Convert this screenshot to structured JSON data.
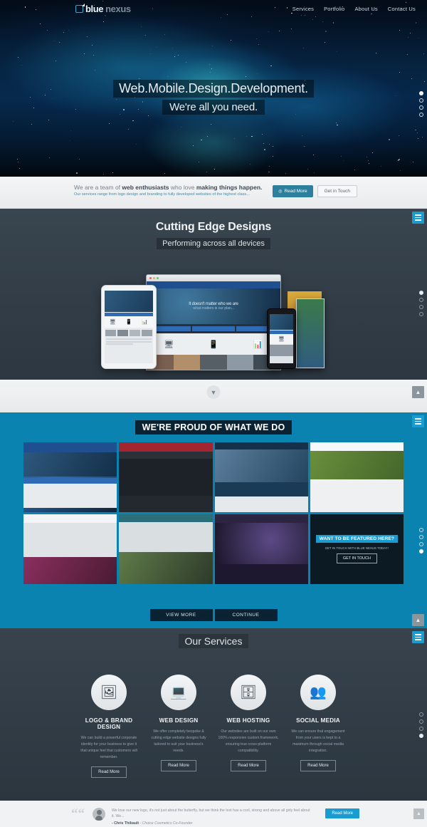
{
  "brand": {
    "logo_blue": "blue",
    "logo_nexus": "nexus",
    "logo_icon": "bluenexus-logo-icon"
  },
  "nav": {
    "items": [
      "Services",
      "Portfolio",
      "About Us",
      "Contact Us"
    ]
  },
  "hero": {
    "line1": "Web.Mobile.Design.Development.",
    "line2": "We're all you need.",
    "dots": 4,
    "active_dot": 0
  },
  "intro": {
    "text_main_a": "We are a team of ",
    "text_main_b": "web enthusiasts",
    "text_main_c": " who love ",
    "text_main_d": "making things happen.",
    "text_sub": "Our services range from logo design and branding to fully developed websites of the highest class...",
    "read_more": "Read More",
    "read_more_icon": "plus-circle-icon",
    "get_in_touch": "Get in Touch"
  },
  "devices": {
    "title": "Cutting Edge Designs",
    "subtitle": "Performing across all devices",
    "menu_icon": "hamburger-menu-icon",
    "browser_headline": "It doesn't matter who we are",
    "browser_subline": "what matters is our plan...",
    "scroll_down_icon": "chevron-down-icon",
    "scroll_top_icon": "arrow-up-icon",
    "dots": 4,
    "active_dot": 0
  },
  "portfolio": {
    "title": "WE'RE PROUD OF WHAT WE DO",
    "menu_icon": "hamburger-menu-icon",
    "items": [
      {
        "name": "portfolio-thumb-1",
        "accent": "#2f6cb5"
      },
      {
        "name": "portfolio-thumb-2",
        "accent": "#a32530"
      },
      {
        "name": "portfolio-thumb-3",
        "accent": "#1d4a72"
      },
      {
        "name": "portfolio-thumb-4",
        "accent": "#6a8f3c"
      },
      {
        "name": "portfolio-thumb-5",
        "accent": "#8a2f5e"
      },
      {
        "name": "portfolio-thumb-6",
        "accent": "#2a6e7a"
      },
      {
        "name": "portfolio-thumb-7",
        "accent": "#3a3050"
      },
      {
        "name": "portfolio-thumb-8",
        "accent": "#0c1a24"
      }
    ],
    "featured": {
      "headline": "WANT TO BE FEATURED HERE?",
      "subline": "GET IN TOUCH WITH BLUE NEXUS TODAY!",
      "button": "GET IN TOUCH"
    },
    "view_more": "VIEW MORE",
    "continue": "CONTINUE",
    "dots": 4,
    "active_dot": 3,
    "scroll_top_icon": "arrow-up-icon"
  },
  "services": {
    "title": "Our Services",
    "menu_icon": "hamburger-menu-icon",
    "items": [
      {
        "icon": "image-icon",
        "glyph": "ὛC",
        "title": "LOGO & BRAND DESIGN",
        "body": "We can build a powerful corporate identity for your business to give it that unique feel that customers will remember.",
        "button": "Read More"
      },
      {
        "icon": "monitor-icon",
        "glyph": "⬜",
        "title": "WEB DESIGN",
        "body": "We offer completely bespoke & cutting edge website designs fully tailored to suit your business's needs.",
        "button": "Read More"
      },
      {
        "icon": "server-icon",
        "glyph": "⬛",
        "title": "WEB HOSTING",
        "body": "Our websites are built on our own 100% responsive custom framework, ensuring true cross-platform compatibility.",
        "button": "Read More"
      },
      {
        "icon": "people-group-icon",
        "glyph": "὆5",
        "title": "SOCIAL MEDIA",
        "body": "We can ensure that engagement from your users is kept to a maximum through social media integration.",
        "button": "Read More"
      }
    ],
    "dots": 4,
    "active_dot": 3
  },
  "testimonial": {
    "quote_icon": "quote-mark-icon",
    "avatar_icon": "user-avatar-icon",
    "text": "We love our new logo, it's not just about the butterfly, but we think the text has a cool, strong and above all girly feel about it. We...",
    "author": "- Chris Thibault",
    "role": " - Choice Cosmetics Co-Founder",
    "button": "Read More",
    "scroll_top_icon": "arrow-up-icon"
  },
  "colors": {
    "brand_blue": "#1b9cd0",
    "portfolio_bg": "#0a83b0",
    "dark_slate": "#2c3742",
    "intro_button": "#2d7f9e"
  }
}
